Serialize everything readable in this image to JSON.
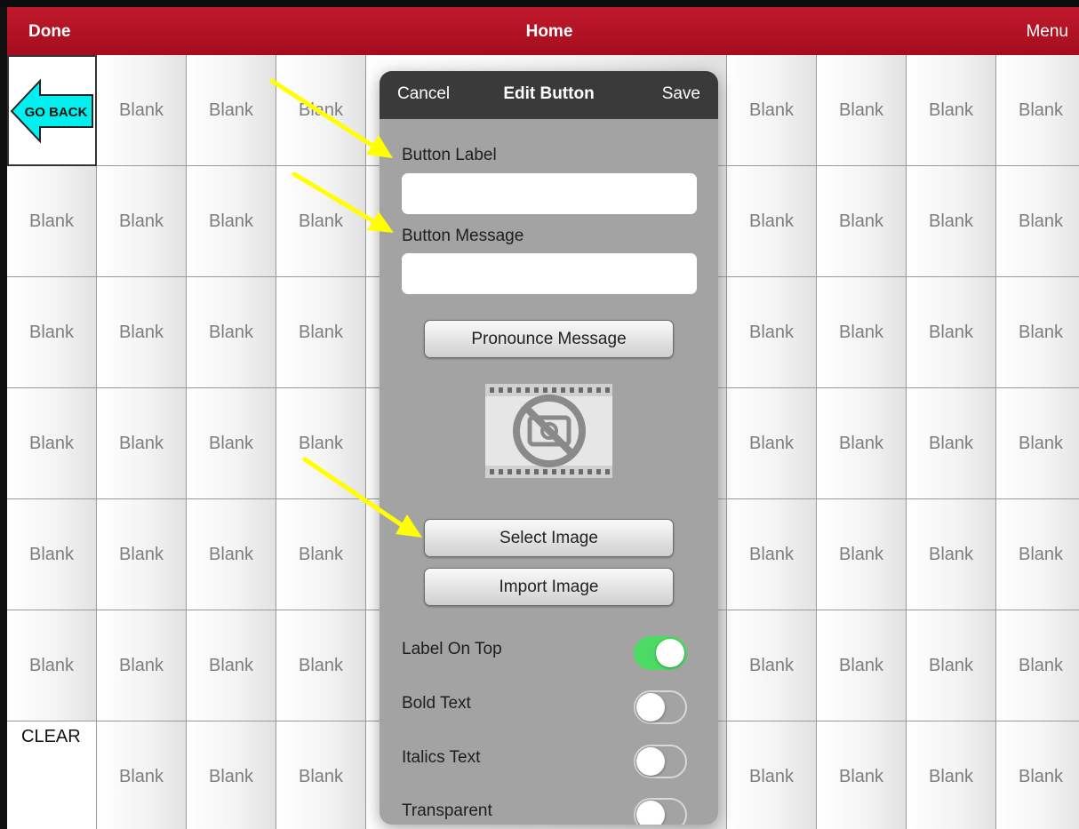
{
  "nav": {
    "left": "Done",
    "title": "Home",
    "right": "Menu"
  },
  "grid": {
    "go_back_label": "GO BACK",
    "clear_label": "CLEAR",
    "cell_label": "Blank",
    "left_cells": [
      [
        null,
        "Blank",
        "Blank",
        "Blank"
      ],
      [
        "Blank",
        "Blank",
        "Blank",
        "Blank"
      ],
      [
        "Blank",
        "Blank",
        "Blank",
        "Blank"
      ],
      [
        "Blank",
        "Blank",
        "Blank",
        "Blank"
      ],
      [
        "Blank",
        "Blank",
        "Blank",
        "Blank"
      ],
      [
        "Blank",
        "Blank",
        "Blank",
        "Blank"
      ],
      [
        null,
        "Blank",
        "Blank",
        "Blank"
      ]
    ],
    "right_cells": [
      [
        "Blank",
        "Blank",
        "Blank",
        "Blank"
      ],
      [
        "Blank",
        "Blank",
        "Blank",
        "Blank"
      ],
      [
        "Blank",
        "Blank",
        "Blank",
        "Blank"
      ],
      [
        "Blank",
        "Blank",
        "Blank",
        "Blank"
      ],
      [
        "Blank",
        "Blank",
        "Blank",
        "Blank"
      ],
      [
        "Blank",
        "Blank",
        "Blank",
        "Blank"
      ],
      [
        "Blank",
        "Blank",
        "Blank",
        "Blank"
      ]
    ]
  },
  "dialog": {
    "cancel": "Cancel",
    "title": "Edit Button",
    "save": "Save",
    "button_label": {
      "label": "Button Label",
      "value": ""
    },
    "button_message": {
      "label": "Button Message",
      "value": ""
    },
    "pronounce_button": "Pronounce Message",
    "image_placeholder_icon": "no-image-icon",
    "select_image_button": "Select Image",
    "import_image_button": "Import Image",
    "toggles": [
      {
        "label": "Label On Top",
        "on": true
      },
      {
        "label": "Bold Text",
        "on": false
      },
      {
        "label": "Italics Text",
        "on": false
      },
      {
        "label": "Transparent",
        "on": false
      }
    ]
  },
  "colors": {
    "nav_bar": "#b0111f",
    "dialog_body": "#a3a3a3",
    "dialog_header": "#3a3a3a",
    "toggle_on": "#4cd964",
    "go_back_arrow": "#00f0f0",
    "annotation_arrow": "#ffff00"
  }
}
